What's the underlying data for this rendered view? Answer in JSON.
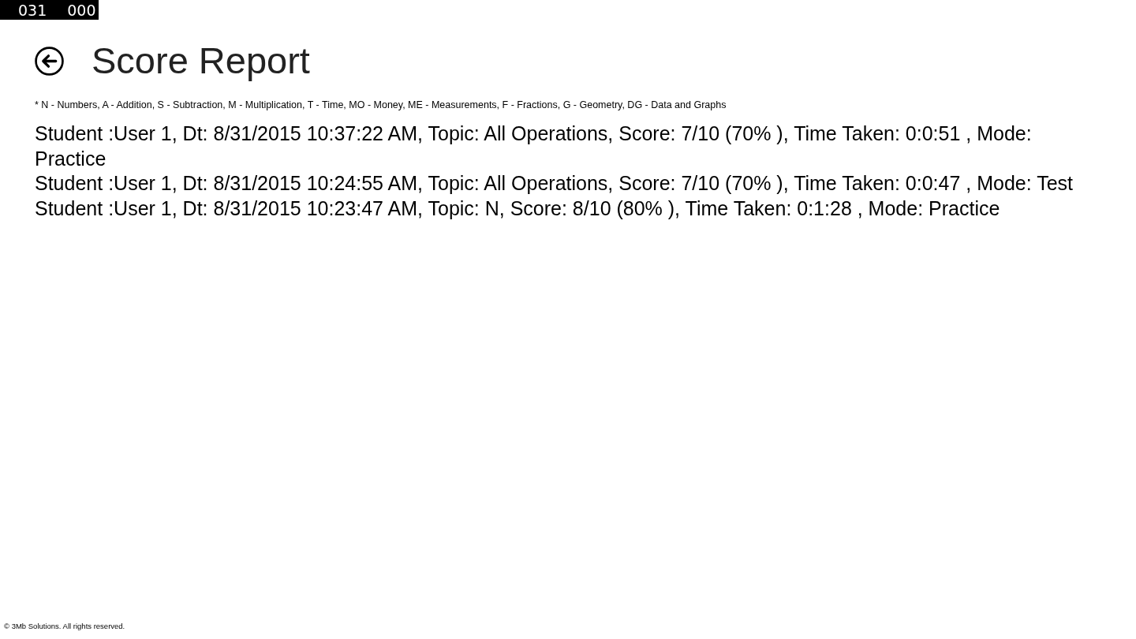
{
  "frame_counter": {
    "values": [
      "031",
      "000"
    ]
  },
  "header": {
    "title": "Score Report"
  },
  "legend": "* N - Numbers, A - Addition, S - Subtraction, M - Multiplication, T - Time, MO - Money, ME - Measurements, F - Fractions, G - Geometry, DG - Data and Graphs",
  "records": [
    "Student :User 1, Dt: 8/31/2015 10:37:22 AM, Topic: All Operations, Score: 7/10 (70% ), Time Taken: 0:0:51 , Mode: Practice",
    "Student :User 1, Dt: 8/31/2015 10:24:55 AM, Topic: All Operations, Score: 7/10 (70% ), Time Taken: 0:0:47 , Mode: Test",
    "Student :User 1, Dt: 8/31/2015 10:23:47 AM, Topic: N, Score: 8/10 (80% ), Time Taken: 0:1:28 , Mode: Practice"
  ],
  "footer": "© 3Mb Solutions. All rights reserved."
}
